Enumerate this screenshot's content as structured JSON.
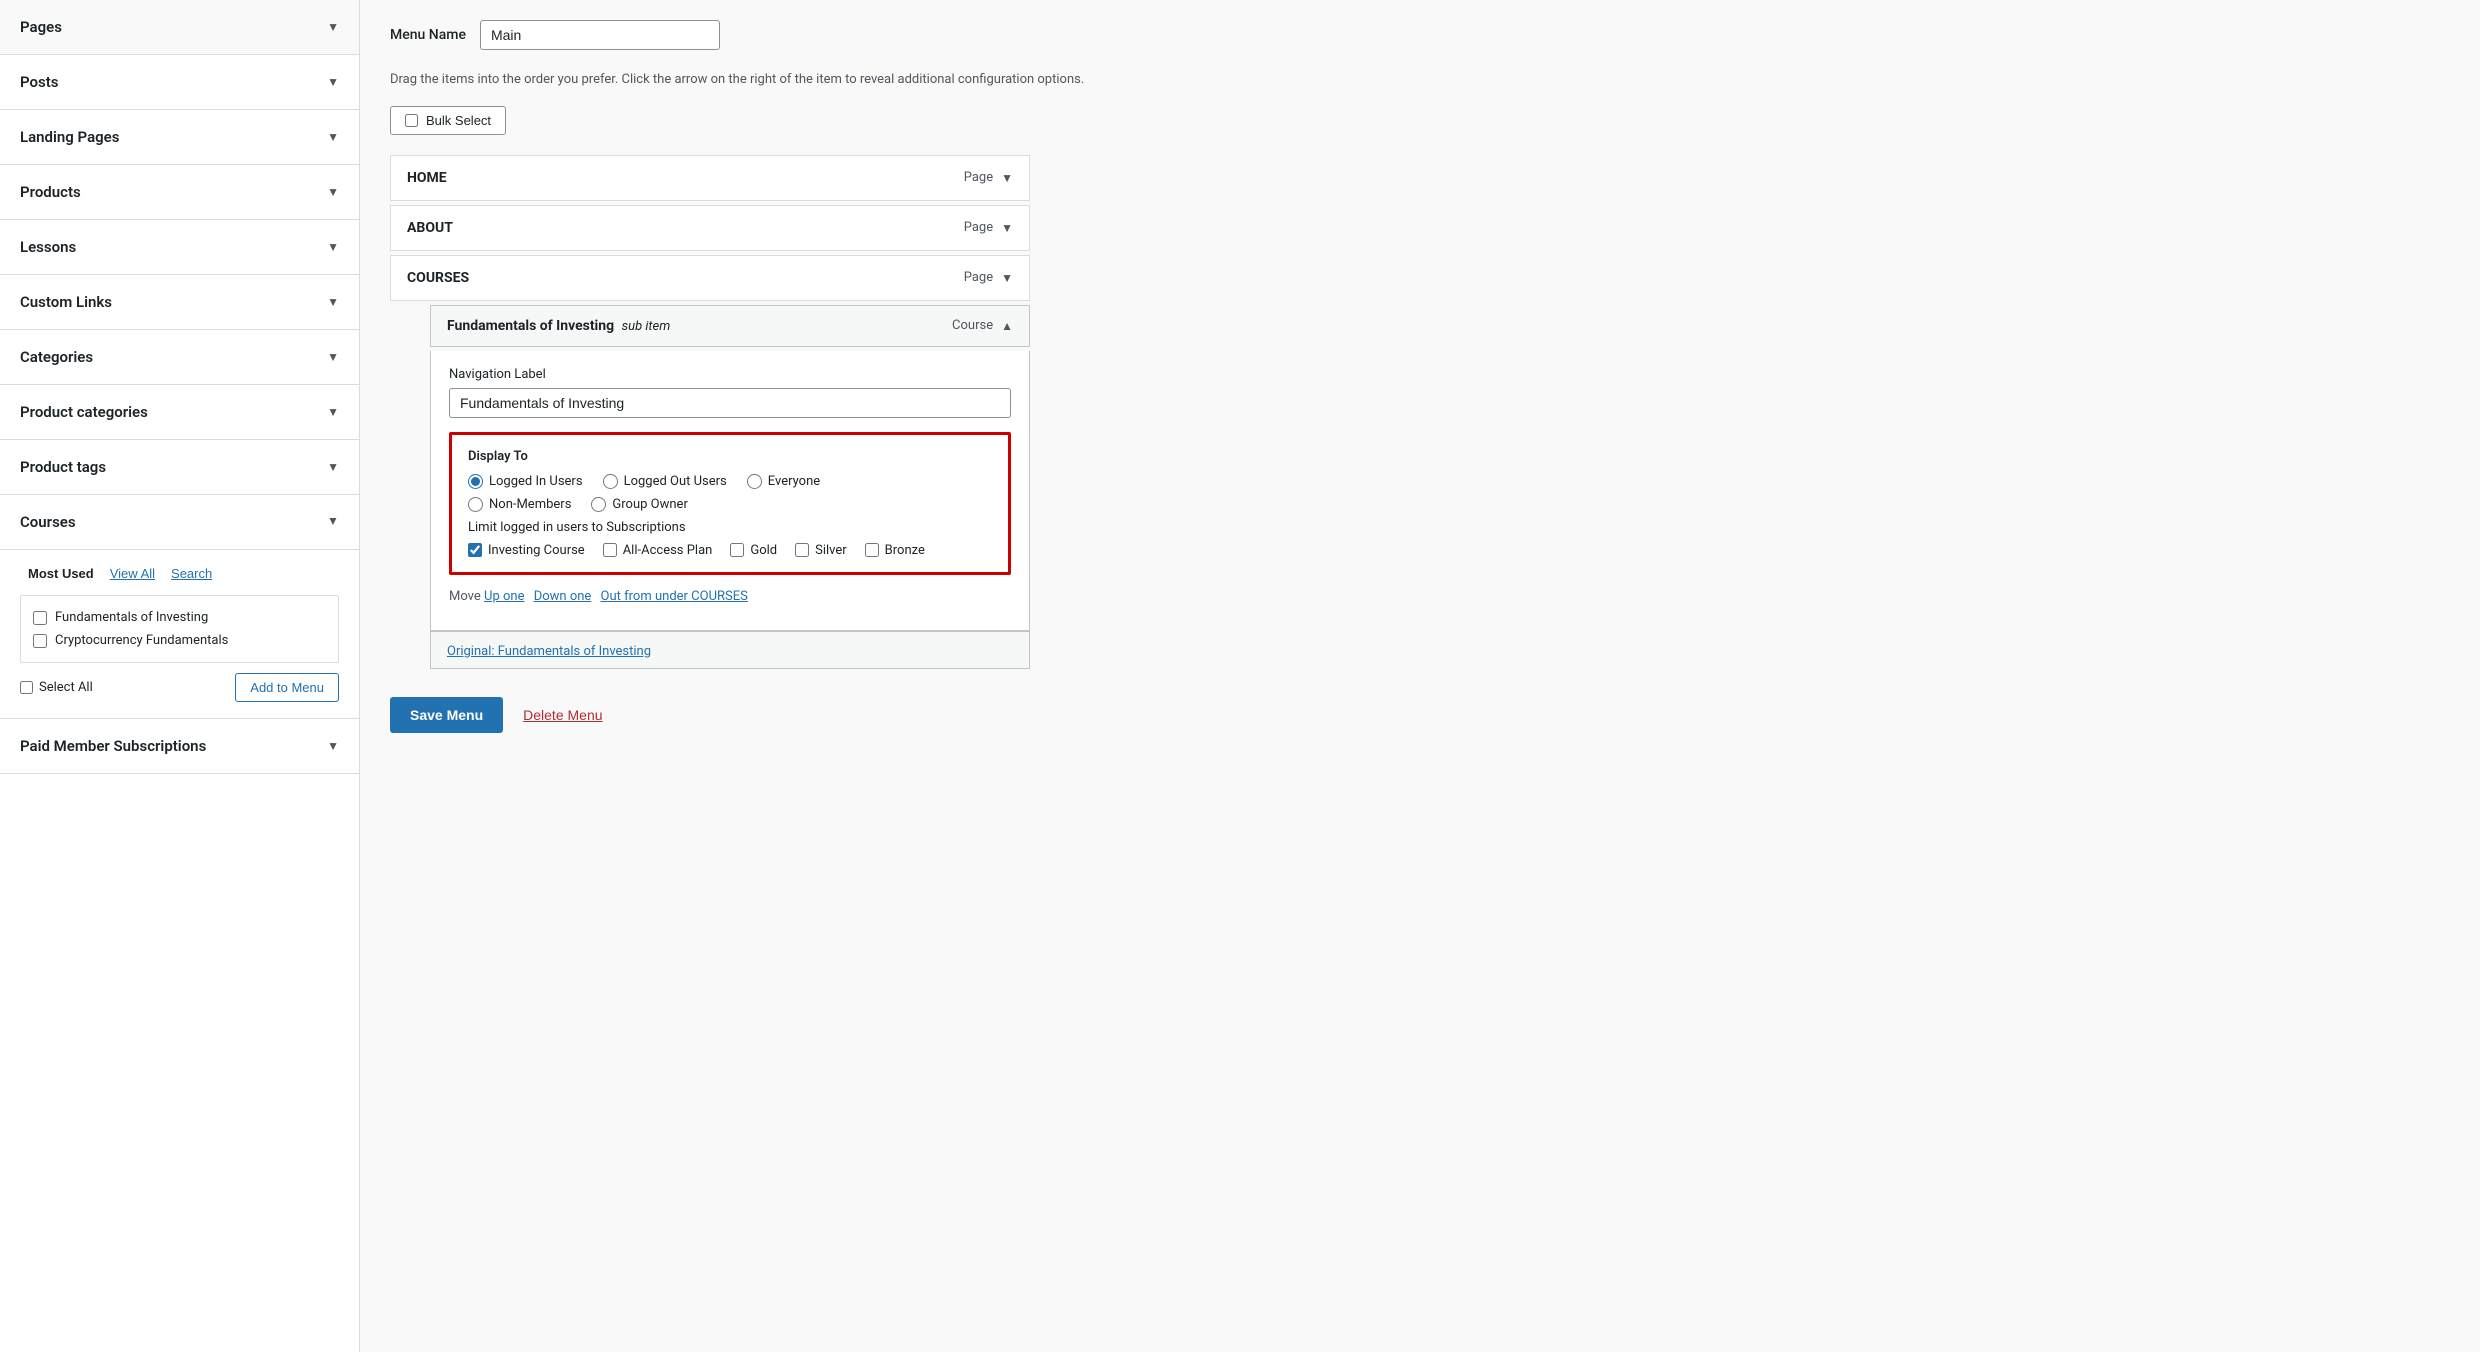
{
  "sidebar": {
    "items": [
      {
        "label": "Pages",
        "expanded": false
      },
      {
        "label": "Posts",
        "expanded": false
      },
      {
        "label": "Landing Pages",
        "expanded": false
      },
      {
        "label": "Products",
        "expanded": false
      },
      {
        "label": "Lessons",
        "expanded": false
      },
      {
        "label": "Custom Links",
        "expanded": false
      },
      {
        "label": "Categories",
        "expanded": false
      },
      {
        "label": "Product categories",
        "expanded": false
      },
      {
        "label": "Product tags",
        "expanded": false
      },
      {
        "label": "Courses",
        "expanded": true
      },
      {
        "label": "Paid Member Subscriptions",
        "expanded": false
      }
    ],
    "courses_tabs": {
      "most_used": "Most Used",
      "view_all": "View All",
      "search": "Search"
    },
    "courses_list": [
      {
        "label": "Fundamentals of Investing"
      },
      {
        "label": "Cryptocurrency Fundamentals"
      }
    ],
    "select_all_label": "Select All",
    "add_to_menu_label": "Add to Menu"
  },
  "main": {
    "menu_name_label": "Menu Name",
    "menu_name_value": "Main",
    "drag_hint": "Drag the items into the order you prefer. Click the arrow on the right of the item to reveal additional configuration options.",
    "bulk_select_label": "Bulk Select",
    "menu_items": [
      {
        "title": "HOME",
        "type": "Page"
      },
      {
        "title": "ABOUT",
        "type": "Page"
      },
      {
        "title": "COURSES",
        "type": "Page"
      }
    ],
    "sub_item": {
      "title": "Fundamentals of Investing",
      "subtitle": "sub item",
      "type": "Course",
      "nav_label": "Fundamentals of Investing",
      "nav_label_heading": "Navigation Label",
      "display_to": {
        "heading": "Display To",
        "options": [
          {
            "label": "Logged In Users",
            "checked": true
          },
          {
            "label": "Logged Out Users",
            "checked": false
          },
          {
            "label": "Everyone",
            "checked": false
          },
          {
            "label": "Non-Members",
            "checked": false
          },
          {
            "label": "Group Owner",
            "checked": false
          }
        ],
        "subscriptions_heading": "Limit logged in users to Subscriptions",
        "subscriptions": [
          {
            "label": "Investing Course",
            "checked": true
          },
          {
            "label": "All-Access Plan",
            "checked": false
          },
          {
            "label": "Gold",
            "checked": false
          },
          {
            "label": "Silver",
            "checked": false
          },
          {
            "label": "Bronze",
            "checked": false
          }
        ]
      },
      "move_label": "Move",
      "move_links": [
        "Up one",
        "Down one",
        "Out from under COURSES"
      ]
    },
    "next_sub_preview": "Original: Fundamentals of Investing",
    "save_menu_label": "Save Menu",
    "delete_menu_label": "Delete Menu"
  }
}
